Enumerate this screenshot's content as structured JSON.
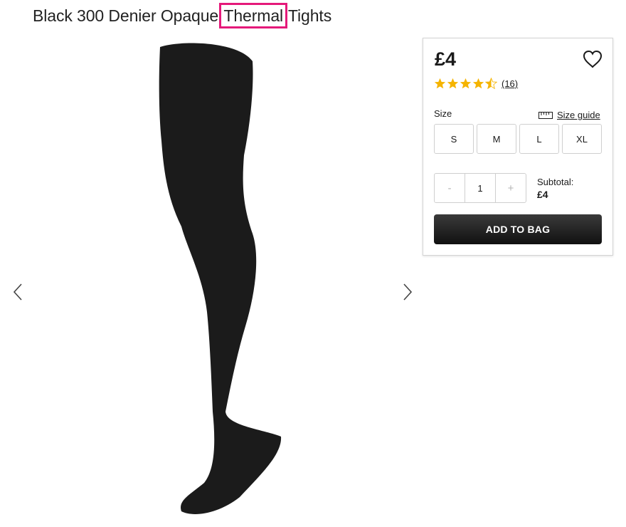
{
  "product": {
    "title_before": "Black 300 Denier Opaque ",
    "title_highlight": "Thermal",
    "title_after": " Tights",
    "image_icon": "tights-product-image"
  },
  "gallery": {
    "prev_icon": "chevron-left-icon",
    "next_icon": "chevron-right-icon"
  },
  "buy_box": {
    "price": "£4",
    "wishlist_icon": "heart-icon",
    "rating": 4.5,
    "review_count": "(16)",
    "size_label": "Size",
    "size_guide_label": "Size guide",
    "size_guide_icon": "ruler-icon",
    "sizes": [
      "S",
      "M",
      "L",
      "XL"
    ],
    "quantity": {
      "decrement": "-",
      "value": "1",
      "increment": "+"
    },
    "subtotal_label": "Subtotal:",
    "subtotal_value": "£4",
    "add_to_bag_label": "ADD TO BAG"
  },
  "colors": {
    "highlight": "#e5197a",
    "star": "#f5b400",
    "button": "#111111"
  }
}
